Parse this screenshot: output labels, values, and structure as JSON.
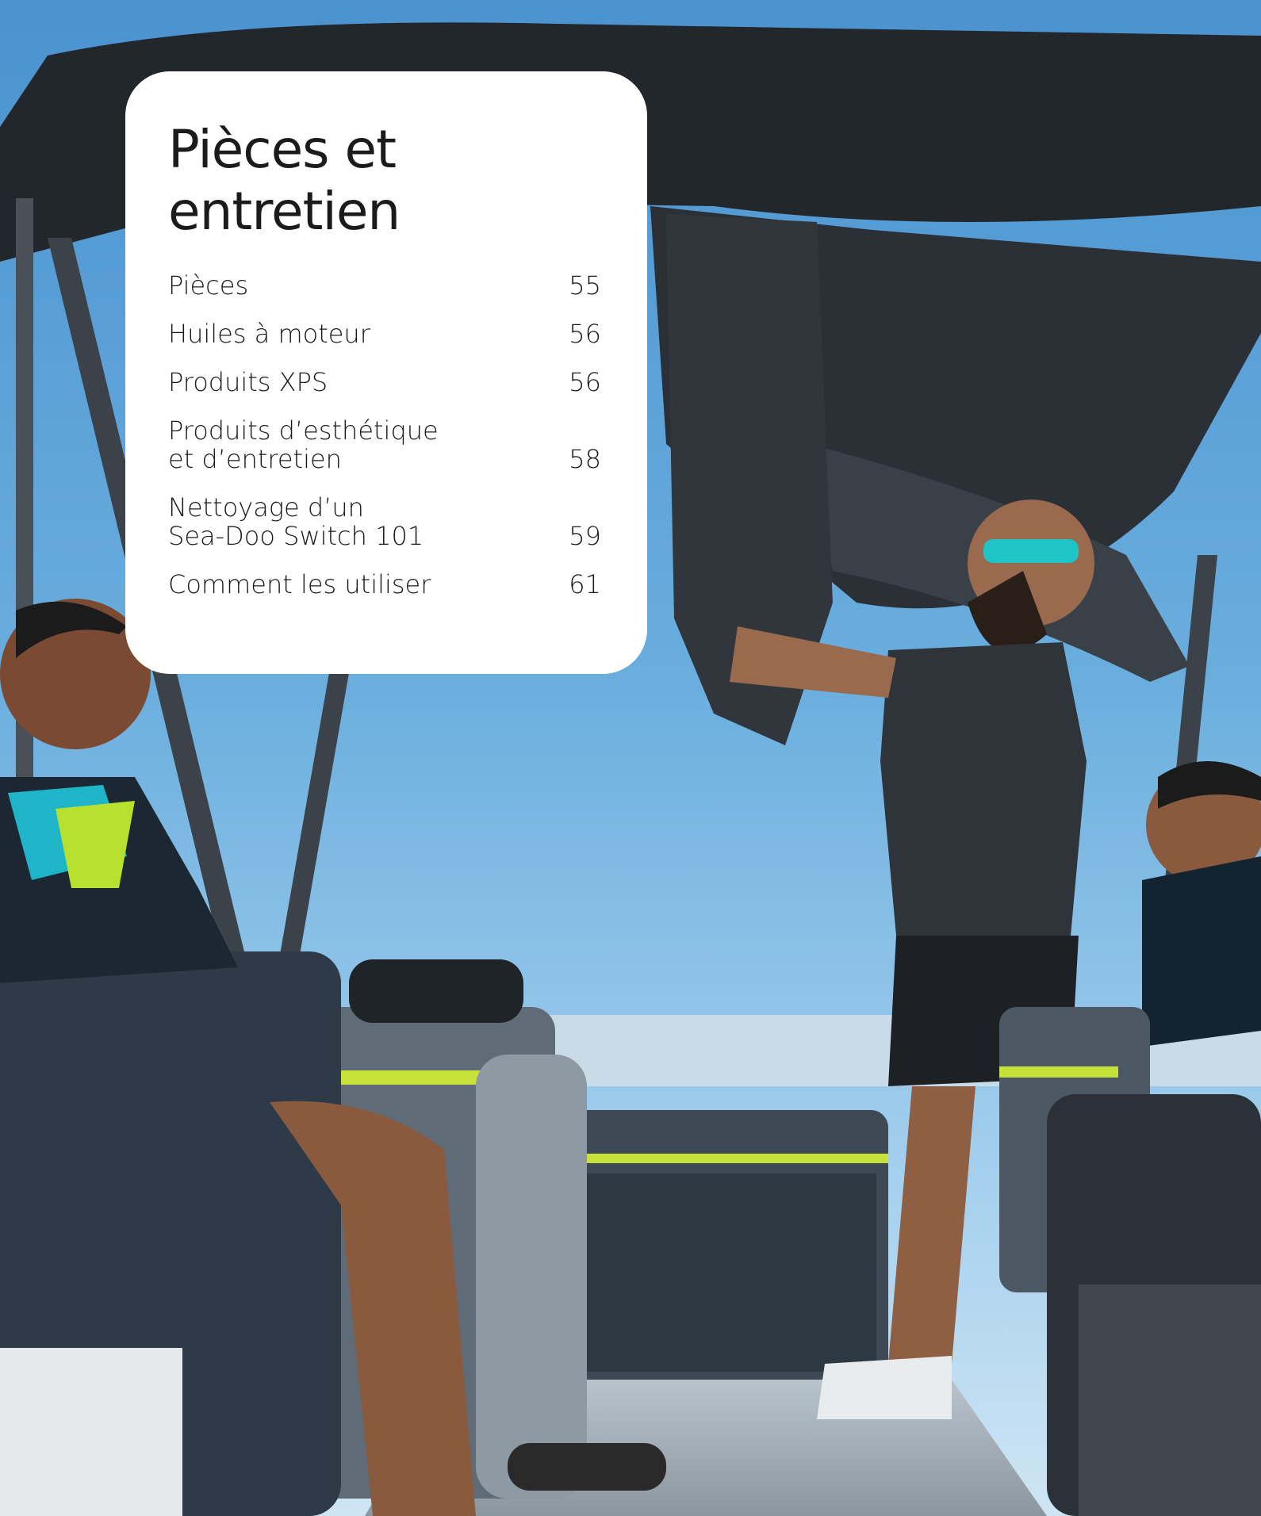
{
  "card": {
    "title_lines": [
      "Pièces et",
      "entretien"
    ]
  },
  "toc": [
    {
      "label_lines": [
        "Pièces"
      ],
      "page": "55"
    },
    {
      "label_lines": [
        "Huiles à moteur"
      ],
      "page": "56"
    },
    {
      "label_lines": [
        "Produits XPS"
      ],
      "page": "56"
    },
    {
      "label_lines": [
        "Produits d’esthétique",
        "et d’entretien"
      ],
      "page": "58"
    },
    {
      "label_lines": [
        "Nettoyage d’un",
        "Sea-Doo Switch 101"
      ],
      "page": "59"
    },
    {
      "label_lines": [
        "Comment les utiliser"
      ],
      "page": "61"
    }
  ],
  "colors": {
    "card_bg": "#ffffff",
    "text": "#1b1b1b",
    "sky": "#5a9ed6",
    "accent_lime": "#c6e23a"
  }
}
